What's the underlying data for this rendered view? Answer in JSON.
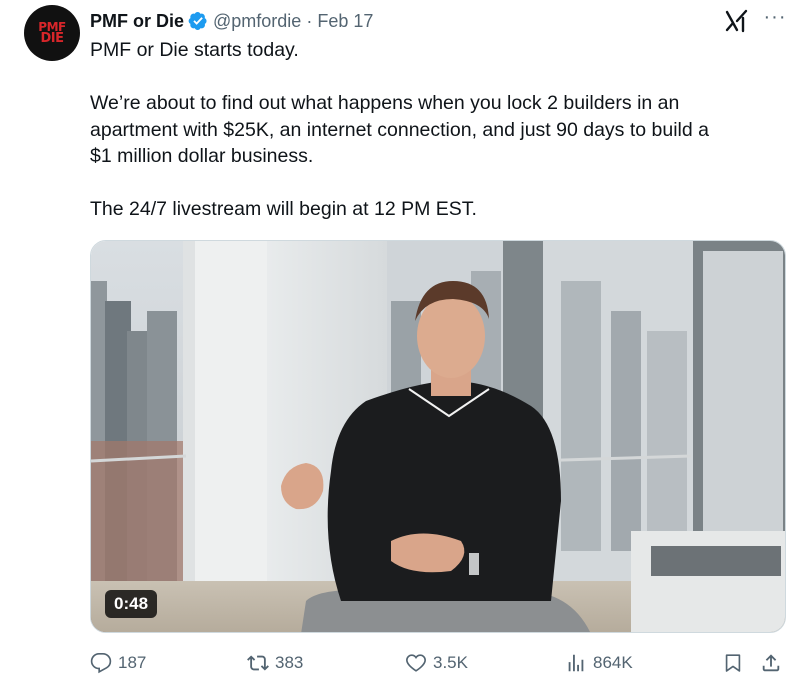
{
  "account": {
    "display_name": "PMF or Die",
    "handle": "@pmfordie",
    "separator": "·",
    "date": "Feb 17",
    "avatar_text_line1": "PMF",
    "avatar_text_line2": "DIE",
    "verified_color": "#1d9bf0"
  },
  "tweet": {
    "paragraphs": [
      "PMF or Die starts today.",
      "We’re about to find out what happens when you lock 2 builders in an\napartment with $25K, an internet connection, and just 90 days to build a\n$1 million dollar business.",
      "The 24/7 livestream will begin at 12 PM EST."
    ]
  },
  "media": {
    "type": "video",
    "duration": "0:48"
  },
  "actions": {
    "replies": "187",
    "reposts": "383",
    "likes": "3.5K",
    "views": "864K",
    "icons": [
      "reply-icon",
      "repost-icon",
      "like-icon",
      "views-icon",
      "bookmark-icon",
      "share-icon"
    ]
  },
  "colors": {
    "text_primary": "#0f1419",
    "text_secondary": "#536471",
    "accent": "#1d9bf0"
  }
}
